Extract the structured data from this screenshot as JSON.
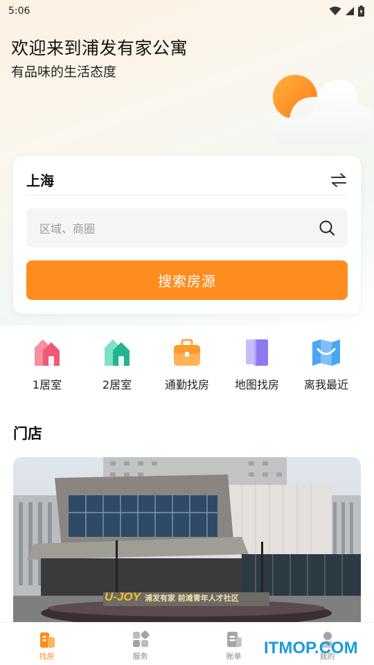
{
  "status_bar": {
    "time": "5:06"
  },
  "hero": {
    "title": "欢迎来到浦发有家公寓",
    "subtitle": "有品味的生活态度"
  },
  "search": {
    "city": "上海",
    "placeholder": "区域、商圈",
    "button_label": "搜索房源"
  },
  "quick_links": [
    {
      "label": "1居室",
      "icon": "pink-house-icon",
      "color": "#f0607a"
    },
    {
      "label": "2居室",
      "icon": "teal-house-icon",
      "color": "#2fbf9b"
    },
    {
      "label": "通勤找房",
      "icon": "briefcase-icon",
      "color": "#ffa030"
    },
    {
      "label": "地图找房",
      "icon": "book-map-icon",
      "color": "#9a86f0"
    },
    {
      "label": "离我最近",
      "icon": "folded-map-icon",
      "color": "#3d9bf0"
    }
  ],
  "stores": {
    "section_title": "门店",
    "sign_brand": "U-JOY",
    "sign_text": "浦发有家 前滩青年人才社区"
  },
  "tab_bar": {
    "items": [
      {
        "label": "找房",
        "active": true
      },
      {
        "label": "服务",
        "active": false
      },
      {
        "label": "账单",
        "active": false
      },
      {
        "label": "我的",
        "active": false
      }
    ]
  },
  "watermark": "ITMOP.COM",
  "colors": {
    "accent": "#ff8c1f",
    "watermark": "#1a9bd8"
  }
}
